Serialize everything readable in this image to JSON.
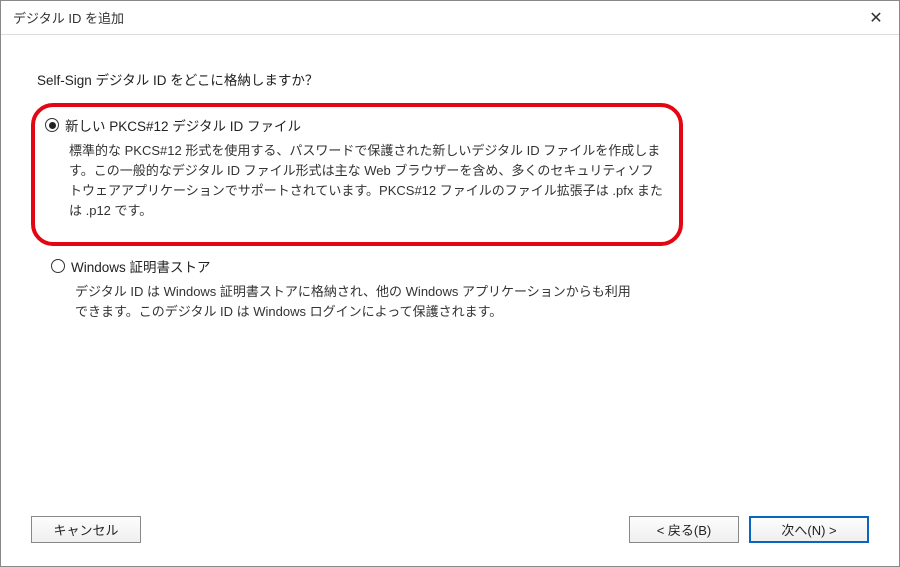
{
  "titlebar": {
    "title": "デジタル ID を追加"
  },
  "content": {
    "question": "Self-Sign デジタル ID をどこに格納しますか？",
    "option1": {
      "label": "新しい PKCS#12 デジタル ID ファイル",
      "description": "標準的な PKCS#12 形式を使用する、パスワードで保護された新しいデジタル ID ファイルを作成します。この一般的なデジタル ID ファイル形式は主な Web ブラウザーを含め、多くのセキュリティソフトウェアアプリケーションでサポートされています。PKCS#12 ファイルのファイル拡張子は .pfx または .p12 です。"
    },
    "option2": {
      "label": "Windows 証明書ストア",
      "description": "デジタル ID は Windows 証明書ストアに格納され、他の Windows アプリケーションからも利用できます。このデジタル ID は Windows ログインによって保護されます。"
    }
  },
  "footer": {
    "cancel": "キャンセル",
    "back": "< 戻る(B)",
    "next": "次へ(N) >"
  },
  "selected_option": "option1",
  "highlight_color": "#e30613",
  "primary_border_color": "#0a64c2"
}
